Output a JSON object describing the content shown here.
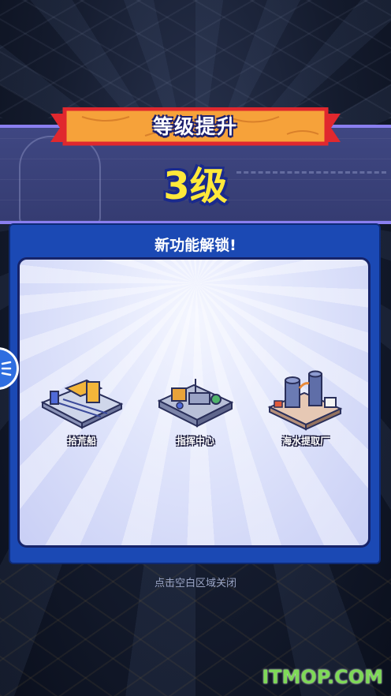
{
  "dialog": {
    "banner_title": "等级提升",
    "level_value": "3级",
    "section_title": "新功能解锁!",
    "close_hint": "点击空白区域关闭"
  },
  "unlocked_features": [
    {
      "label": "拾荒船",
      "icon": "salvage-ship-building-icon"
    },
    {
      "label": "指挥中心",
      "icon": "command-center-building-icon"
    },
    {
      "label": "海水提取厂",
      "icon": "seawater-extraction-plant-icon"
    }
  ],
  "side_button": {
    "icon": "menu-lines-icon"
  },
  "watermark": "ITMOP.COM",
  "colors": {
    "ribbon": "#f6a23a",
    "ribbon_border": "#e0282e",
    "level_text": "#ffe93a",
    "panel": "#1b49b4",
    "inner_panel": "#dfe4fb",
    "band": "#3f4782"
  }
}
